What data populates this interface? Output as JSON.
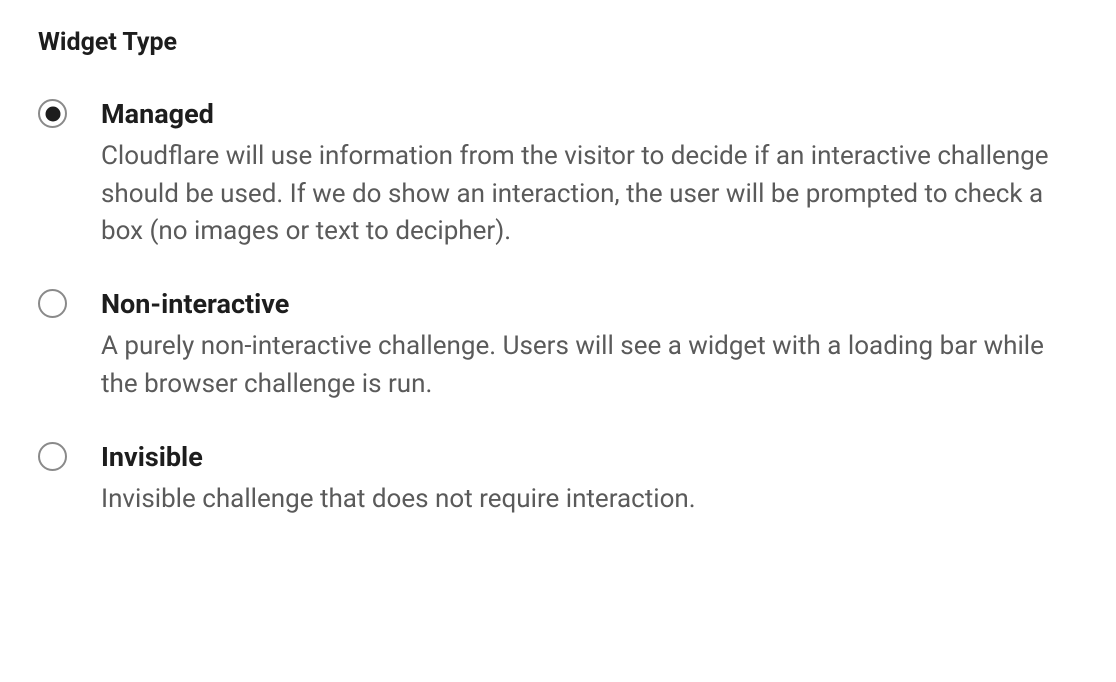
{
  "section": {
    "heading": "Widget Type"
  },
  "options": [
    {
      "label": "Managed",
      "description": "Cloudflare will use information from the visitor to decide if an interactive challenge should be used. If we do show an interaction, the user will be prompted to check a box (no images or text to decipher).",
      "selected": true
    },
    {
      "label": "Non-interactive",
      "description": "A purely non-interactive challenge. Users will see a widget with a loading bar while the browser challenge is run.",
      "selected": false
    },
    {
      "label": "Invisible",
      "description": "Invisible challenge that does not require interaction.",
      "selected": false
    }
  ]
}
